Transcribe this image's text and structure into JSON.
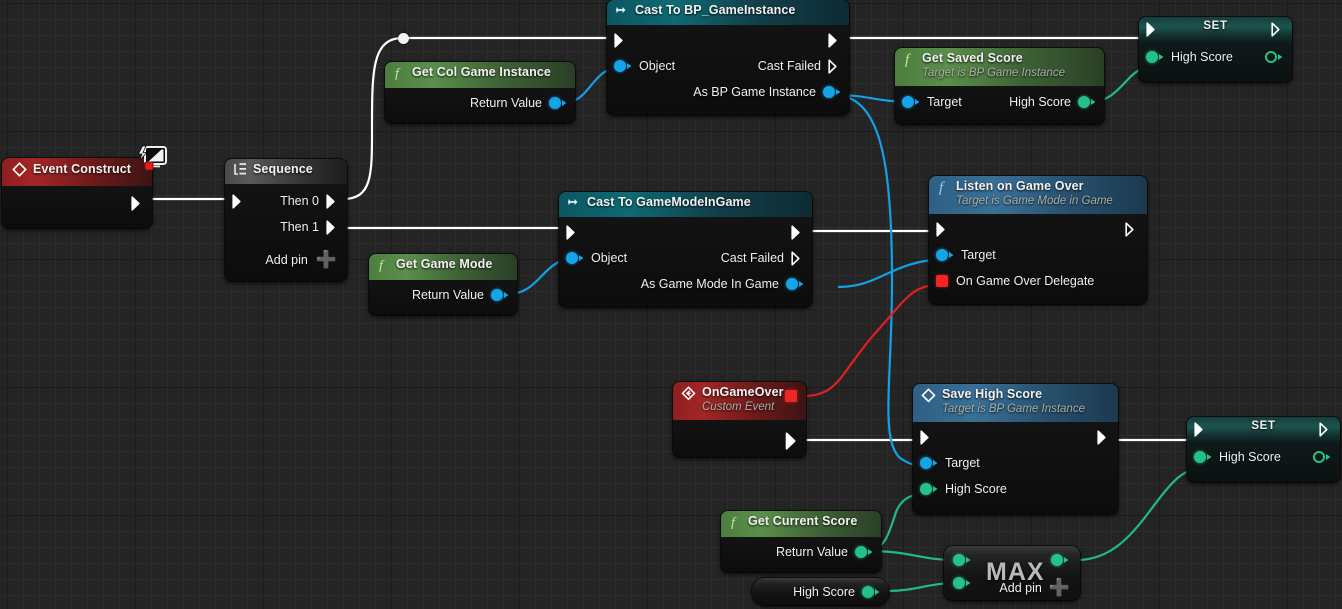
{
  "graph": {
    "app": "Unreal Engine Blueprint Event Graph",
    "background_color": "#242424",
    "grid_color": "#2d2d2d",
    "grid_major_color": "#1b1b1b"
  },
  "wire_colors": {
    "exec": "#ffffff",
    "object": "#13a0e6",
    "integer": "#22b98a",
    "delegate": "#e02020"
  },
  "nodes": {
    "event_construct": {
      "title": "Event Construct",
      "icon": "event-diamond-icon",
      "badge": "monitor-lightning-icon",
      "out_exec": ""
    },
    "sequence": {
      "title": "Sequence",
      "icon": "sequence-icon",
      "outputs": [
        "Then 0",
        "Then 1"
      ],
      "add_pin": "Add pin"
    },
    "get_col_game_instance": {
      "title": "Get Col Game Instance",
      "icon": "function-f-icon",
      "output": "Return Value"
    },
    "cast_bp_gameinstance": {
      "title": "Cast To BP_GameInstance",
      "icon": "cast-arrow-icon",
      "input_data": "Object",
      "out_cast_failed": "Cast Failed",
      "out_as": "As BP Game Instance"
    },
    "get_saved_score": {
      "title": "Get Saved Score",
      "subtitle": "Target is BP Game Instance",
      "icon": "function-f-icon",
      "input_target": "Target",
      "output_high_score": "High Score"
    },
    "set_high_score_top": {
      "title": "SET",
      "input_high_score": "High Score"
    },
    "get_game_mode": {
      "title": "Get Game Mode",
      "icon": "function-f-icon",
      "output": "Return Value"
    },
    "cast_gamemodeingame": {
      "title": "Cast To GameModeInGame",
      "icon": "cast-arrow-icon",
      "input_data": "Object",
      "out_cast_failed": "Cast Failed",
      "out_as": "As Game Mode In Game"
    },
    "listen_on_game_over": {
      "title": "Listen on Game Over",
      "subtitle": "Target is Game Mode in Game",
      "icon": "function-f-icon",
      "input_target": "Target",
      "input_delegate": "On Game Over Delegate"
    },
    "on_game_over": {
      "title": "OnGameOver",
      "subtitle": "Custom Event",
      "icon": "event-diamond-icon"
    },
    "save_high_score": {
      "title": "Save High Score",
      "subtitle": "Target is BP Game Instance",
      "icon": "event-diamond-icon",
      "input_target": "Target",
      "input_high_score": "High Score"
    },
    "set_high_score_bottom": {
      "title": "SET",
      "input_high_score": "High Score"
    },
    "get_current_score": {
      "title": "Get Current Score",
      "icon": "function-f-icon",
      "output": "Return Value"
    },
    "high_score_var": {
      "title": "High Score"
    },
    "max_node": {
      "title": "MAX",
      "add_pin": "Add pin"
    }
  }
}
